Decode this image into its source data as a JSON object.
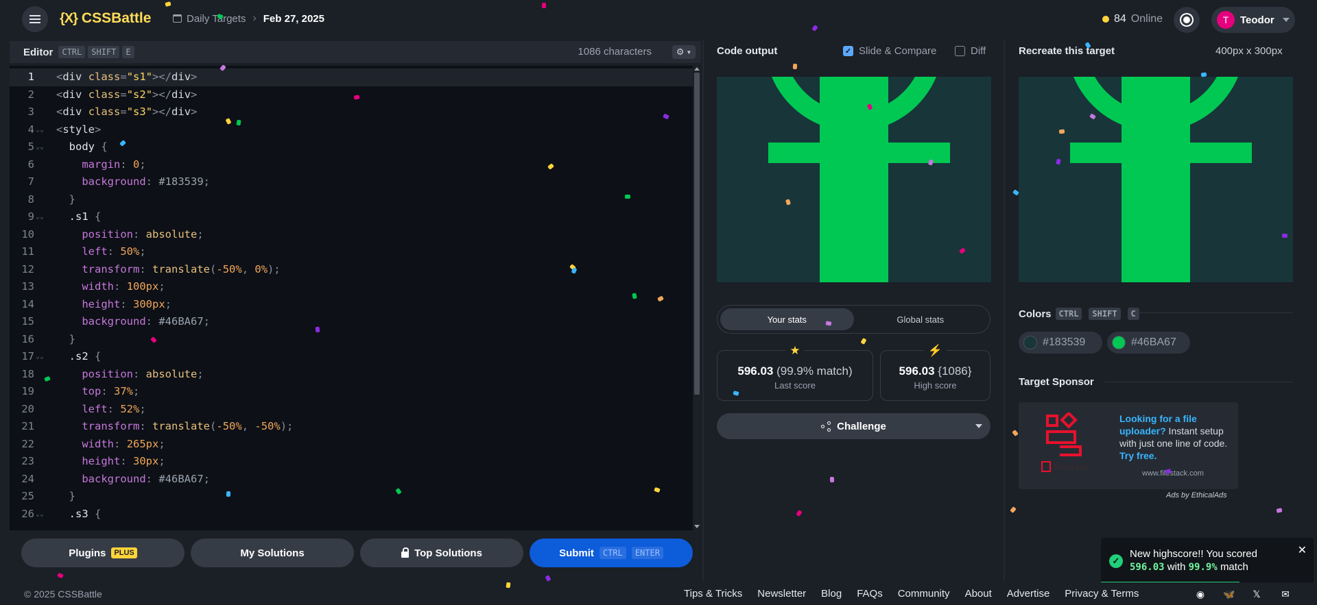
{
  "header": {
    "logo_mark": "{X}",
    "logo_text": "CSSBattle",
    "breadcrumb_parent": "Daily Targets",
    "breadcrumb_current": "Feb 27, 2025",
    "online_count": "84",
    "online_label": "Online",
    "user_initial": "T",
    "user_name": "Teodor"
  },
  "editor": {
    "title": "Editor",
    "shortcut": [
      "CTRL",
      "SHIFT",
      "E"
    ],
    "char_count": "1086 characters",
    "lines": [
      {
        "n": "1",
        "fold": "",
        "html": "<span class='t-punct'>&lt;</span><span class='t-tag'>div</span> <span class='t-attr'>class</span><span class='t-punct'>=</span><span class='t-str'>\"s1\"</span><span class='t-punct'>&gt;&lt;/</span><span class='t-tag'>div</span><span class='t-punct'>&gt;</span>"
      },
      {
        "n": "2",
        "fold": "",
        "html": "<span class='t-punct'>&lt;</span><span class='t-tag'>div</span> <span class='t-attr'>class</span><span class='t-punct'>=</span><span class='t-str'>\"s2\"</span><span class='t-punct'>&gt;&lt;/</span><span class='t-tag'>div</span><span class='t-punct'>&gt;</span>"
      },
      {
        "n": "3",
        "fold": "",
        "html": "<span class='t-punct'>&lt;</span><span class='t-tag'>div</span> <span class='t-attr'>class</span><span class='t-punct'>=</span><span class='t-str'>\"s3\"</span><span class='t-punct'>&gt;&lt;/</span><span class='t-tag'>div</span><span class='t-punct'>&gt;</span>"
      },
      {
        "n": "4",
        "fold": "⌄⌄",
        "html": "<span class='t-punct'>&lt;</span><span class='t-tag'>style</span><span class='t-punct'>&gt;</span>"
      },
      {
        "n": "5",
        "fold": "⌄⌄",
        "html": "  <span class='t-sel'>body</span> <span class='t-punct'>{</span>"
      },
      {
        "n": "6",
        "fold": "",
        "html": "    <span class='t-prop'>margin</span><span class='t-punct'>:</span> <span class='t-num'>0</span><span class='t-punct'>;</span>"
      },
      {
        "n": "7",
        "fold": "",
        "html": "    <span class='t-prop'>background</span><span class='t-punct'>:</span> <span class='t-hash'>#183539</span><span class='t-punct'>;</span>"
      },
      {
        "n": "8",
        "fold": "",
        "html": "  <span class='t-punct'>}</span>"
      },
      {
        "n": "9",
        "fold": "⌄⌄",
        "html": "  <span class='t-sel'>.s1</span> <span class='t-punct'>{</span>"
      },
      {
        "n": "10",
        "fold": "",
        "html": "    <span class='t-prop'>position</span><span class='t-punct'>:</span> <span class='t-fn'>absolute</span><span class='t-punct'>;</span>"
      },
      {
        "n": "11",
        "fold": "",
        "html": "    <span class='t-prop'>left</span><span class='t-punct'>:</span> <span class='t-num'>50%</span><span class='t-punct'>;</span>"
      },
      {
        "n": "12",
        "fold": "",
        "html": "    <span class='t-prop'>transform</span><span class='t-punct'>:</span> <span class='t-fn'>translate</span><span class='t-punct'>(</span><span class='t-num'>-50%</span><span class='t-punct'>,</span> <span class='t-num'>0%</span><span class='t-punct'>);</span>"
      },
      {
        "n": "13",
        "fold": "",
        "html": "    <span class='t-prop'>width</span><span class='t-punct'>:</span> <span class='t-num'>100px</span><span class='t-punct'>;</span>"
      },
      {
        "n": "14",
        "fold": "",
        "html": "    <span class='t-prop'>height</span><span class='t-punct'>:</span> <span class='t-num'>300px</span><span class='t-punct'>;</span>"
      },
      {
        "n": "15",
        "fold": "",
        "html": "    <span class='t-prop'>background</span><span class='t-punct'>:</span> <span class='t-hash'>#46BA67</span><span class='t-punct'>;</span>"
      },
      {
        "n": "16",
        "fold": "",
        "html": "  <span class='t-punct'>}</span>"
      },
      {
        "n": "17",
        "fold": "⌄⌄",
        "html": "  <span class='t-sel'>.s2</span> <span class='t-punct'>{</span>"
      },
      {
        "n": "18",
        "fold": "",
        "html": "    <span class='t-prop'>position</span><span class='t-punct'>:</span> <span class='t-fn'>absolute</span><span class='t-punct'>;</span>"
      },
      {
        "n": "19",
        "fold": "",
        "html": "    <span class='t-prop'>top</span><span class='t-punct'>:</span> <span class='t-num'>37%</span><span class='t-punct'>;</span>"
      },
      {
        "n": "20",
        "fold": "",
        "html": "    <span class='t-prop'>left</span><span class='t-punct'>:</span> <span class='t-num'>52%</span><span class='t-punct'>;</span>"
      },
      {
        "n": "21",
        "fold": "",
        "html": "    <span class='t-prop'>transform</span><span class='t-punct'>:</span> <span class='t-fn'>translate</span><span class='t-punct'>(</span><span class='t-num'>-50%</span><span class='t-punct'>,</span> <span class='t-num'>-50%</span><span class='t-punct'>);</span>"
      },
      {
        "n": "22",
        "fold": "",
        "html": "    <span class='t-prop'>width</span><span class='t-punct'>:</span> <span class='t-num'>265px</span><span class='t-punct'>;</span>"
      },
      {
        "n": "23",
        "fold": "",
        "html": "    <span class='t-prop'>height</span><span class='t-punct'>:</span> <span class='t-num'>30px</span><span class='t-punct'>;</span>"
      },
      {
        "n": "24",
        "fold": "",
        "html": "    <span class='t-prop'>background</span><span class='t-punct'>:</span> <span class='t-hash'>#46BA67</span><span class='t-punct'>;</span>"
      },
      {
        "n": "25",
        "fold": "",
        "html": "  <span class='t-punct'>}</span>"
      },
      {
        "n": "26",
        "fold": "⌄⌄",
        "html": "  <span class='t-sel'>.s3</span> <span class='t-punct'>{</span>"
      }
    ]
  },
  "bottom": {
    "plugins": "Plugins",
    "plus": "PLUS",
    "my_solutions": "My Solutions",
    "top_solutions": "Top Solutions",
    "submit": "Submit",
    "submit_keys": [
      "CTRL",
      "ENTER"
    ]
  },
  "output": {
    "title": "Code output",
    "slide_compare": "Slide & Compare",
    "diff": "Diff",
    "tab_yours": "Your stats",
    "tab_global": "Global stats",
    "last_score": "596.03",
    "last_match": "(99.9% match)",
    "last_label": "Last score",
    "high_score": "596.03",
    "high_chars": "{1086}",
    "high_label": "High score",
    "challenge": "Challenge"
  },
  "target": {
    "title": "Recreate this target",
    "size": "400px x 300px",
    "colors_title": "Colors",
    "colors_keys": [
      "CTRL",
      "SHIFT",
      "C"
    ],
    "colors": [
      {
        "label": "#183539",
        "hex": "#183539"
      },
      {
        "label": "#46BA67",
        "hex": "#00c853"
      }
    ],
    "sponsor_title": "Target Sponsor",
    "sponsor_headline": "Looking for a file uploader?",
    "sponsor_body": " Instant setup with just one line of code. ",
    "sponsor_cta": "Try free.",
    "sponsor_url": "www.filestack.com",
    "ads_by": "Ads by EthicalAds"
  },
  "toast": {
    "line1": "New highscore!! You scored",
    "score": "596.03",
    "with": "with",
    "match": "99.9%",
    "suffix": "match",
    "progress": 0.65
  },
  "footer": {
    "copyright": "© 2025 CSSBattle",
    "links": [
      "Tips & Tricks",
      "Newsletter",
      "Blog",
      "FAQs",
      "Community",
      "About",
      "Advertise",
      "Privacy & Terms"
    ]
  },
  "colors": {
    "accent": "#ffdd57",
    "submit_blue": "#0d5cd9",
    "bg_target": "#183539",
    "shape_green": "#00c853"
  }
}
